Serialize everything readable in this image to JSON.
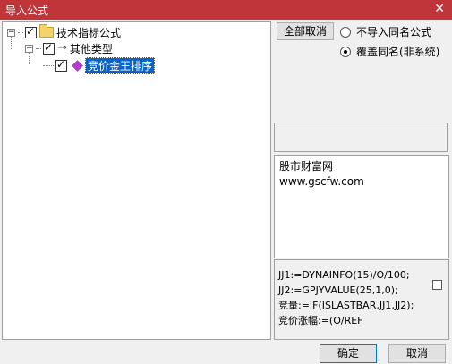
{
  "window": {
    "title": "导入公式",
    "close_glyph": "✕"
  },
  "tree": {
    "root": {
      "label": "技术指标公式",
      "checked": true,
      "expanded": true,
      "icon": "folder-icon"
    },
    "category": {
      "label": "其他类型",
      "checked": true,
      "expanded": true,
      "icon": "key-icon"
    },
    "formula": {
      "label": "竞价金王排序",
      "checked": true,
      "selected": true,
      "icon": "diamond-icon"
    }
  },
  "controls": {
    "cancel_all_label": "全部取消",
    "radio_skip_label": "不导入同名公式",
    "radio_overwrite_label": "覆盖同名(非系统)",
    "selected_option": "overwrite"
  },
  "description": {
    "line1": "股市财富网",
    "line2": "www.gscfw.com"
  },
  "code": {
    "lines": [
      "JJ1:=DYNAINFO(15)/O/100;",
      "JJ2:=GPJYVALUE(25,1,0);",
      "竞量:=IF(ISLASTBAR,JJ1,JJ2);",
      "竞价涨幅:=(O/REF"
    ]
  },
  "footer": {
    "ok_label": "确定",
    "cancel_label": "取消"
  }
}
